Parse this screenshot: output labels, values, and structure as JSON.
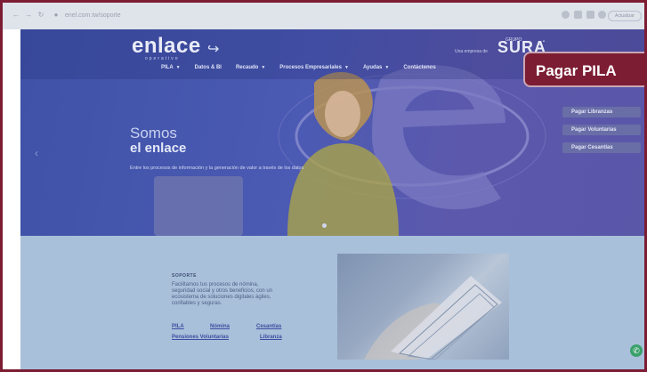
{
  "browser": {
    "url": "enel.com.tw/soporte",
    "update_label": "Actualizar"
  },
  "header": {
    "logo_text": "enlace",
    "logo_sub": "operativo",
    "sura_tagline": "Una empresa de",
    "sura_grupo": "GRUPO",
    "sura_logo": "SURA"
  },
  "menu": [
    {
      "label": "PILA",
      "dropdown": true
    },
    {
      "label": "Datos & BI",
      "dropdown": false
    },
    {
      "label": "Recaudo",
      "dropdown": true
    },
    {
      "label": "Procesos Empresariales",
      "dropdown": true
    },
    {
      "label": "Ayudas",
      "dropdown": true
    },
    {
      "label": "Contáctenos",
      "dropdown": false
    }
  ],
  "hero": {
    "title_line1": "Somos",
    "title_line2": "el enlace",
    "description": "Entre los procesos de información y la generación de valor a través de los datos"
  },
  "pagar": {
    "main_label": "Pagar PILA",
    "sub_items": [
      "Pagar Libranzas",
      "Pagar Voluntarias",
      "Pagar Cesantías"
    ]
  },
  "support": {
    "heading": "SOPORTE",
    "description": "Facilitamos tus procesos de nómina, seguridad social y otros beneficios, con un ecosistema de soluciones digitales ágiles, confiables y seguras.",
    "links": {
      "pila": "PILA",
      "nomina": "Nómina",
      "cesantias": "Cesantías",
      "pensiones": "Pensiones Voluntarias",
      "libranza": "Libranza"
    }
  },
  "colors": {
    "frame_border": "#7c1d33",
    "hero_overlay": "#4b5ab3",
    "pagar_button": "#7c1d33",
    "lower_overlay": "#a9c0da"
  }
}
